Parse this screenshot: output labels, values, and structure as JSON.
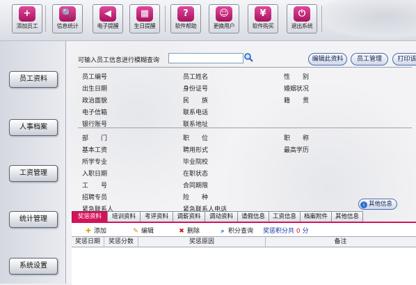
{
  "toolbar": {
    "buttons": [
      {
        "label": "添加员工",
        "icon": "add-user-icon",
        "glyph": "+"
      },
      {
        "label": "信息统计",
        "icon": "search-stats-icon",
        "glyph": "🔍"
      },
      {
        "label": "电子提醒",
        "icon": "speaker-icon",
        "glyph": "◀"
      },
      {
        "label": "生日提醒",
        "icon": "calendar-icon",
        "glyph": "▦"
      },
      {
        "label": "软件帮助",
        "icon": "help-icon",
        "glyph": "?"
      },
      {
        "label": "更换用户",
        "icon": "users-icon",
        "glyph": "☺"
      },
      {
        "label": "软件购买",
        "icon": "yen-icon",
        "glyph": "¥"
      },
      {
        "label": "退出系统",
        "icon": "exit-icon",
        "glyph": "⏻"
      }
    ],
    "accent": "#c0186a"
  },
  "sidebar": {
    "items": [
      {
        "label": "员工资料"
      },
      {
        "label": "人事档案"
      },
      {
        "label": "工资管理"
      },
      {
        "label": "统计管理"
      },
      {
        "label": "系统设置"
      }
    ]
  },
  "search": {
    "label": "可输入员工信息进行模糊查询",
    "value": "",
    "placeholder": ""
  },
  "actions": {
    "edit_label": "编辑此资料",
    "manage_label": "员工管理",
    "print_label": "打印该"
  },
  "fields": {
    "group1": [
      [
        "员工编号",
        "员工姓名",
        "性　　别"
      ],
      [
        "出生日期",
        "身份证号",
        "婚姻状况"
      ],
      [
        "政治面貌",
        "民　　族",
        "籍　　贯"
      ],
      [
        "电子信箱",
        "联系电话",
        ""
      ],
      [
        "银行账号",
        "联系地址",
        ""
      ]
    ],
    "group2": [
      [
        "部　　门",
        "职　　位",
        "职　　称"
      ],
      [
        "基本工资",
        "聘用形式",
        "最高学历"
      ],
      [
        "所学专业",
        "毕业院校",
        ""
      ],
      [
        "入职日期",
        "在职状态",
        ""
      ],
      [
        "工　　号",
        "合同期限",
        ""
      ],
      [
        "招聘专员",
        "险　　种",
        ""
      ],
      [
        "紧急联系人",
        "紧急联系人电话",
        ""
      ]
    ]
  },
  "other_info_label": "其他信息",
  "tabs": [
    "奖惩资料",
    "培训资料",
    "考评资料",
    "调薪资料",
    "调动资料",
    "请假信息",
    "工资信息",
    "档案附件",
    "其他信息"
  ],
  "tab_toolbar": {
    "add": "添加",
    "edit": "编辑",
    "delete": "删除",
    "points_query": "积分查询",
    "total_label": "奖惩积分共",
    "total_value": "0",
    "total_unit": "分"
  },
  "grid": {
    "columns": [
      "奖惩日期",
      "奖惩分数",
      "奖惩原因",
      "备注"
    ]
  }
}
